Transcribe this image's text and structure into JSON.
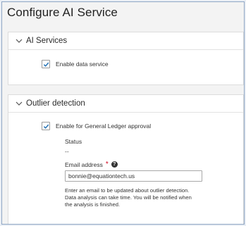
{
  "page": {
    "title": "Configure AI Service"
  },
  "ai_services": {
    "heading": "AI Services",
    "enable_data_service": {
      "label": "Enable data service",
      "checked": true
    }
  },
  "outlier_detection": {
    "heading": "Outlier detection",
    "enable_gl_approval": {
      "label": "Enable for General Ledger approval",
      "checked": true
    },
    "status_label": "Status",
    "status_value": "--",
    "email_label": "Email address",
    "required_mark": "*",
    "help_icon_glyph": "?",
    "email_value": "bonnie@equationtech.us",
    "help_lines": [
      "Enter an email to be updated about outlier detection.",
      "Data analysis can take time. You will be notified when",
      "the analysis is finished."
    ]
  },
  "colors": {
    "checkmark": "#1f6fb3",
    "required": "#d0021b"
  }
}
